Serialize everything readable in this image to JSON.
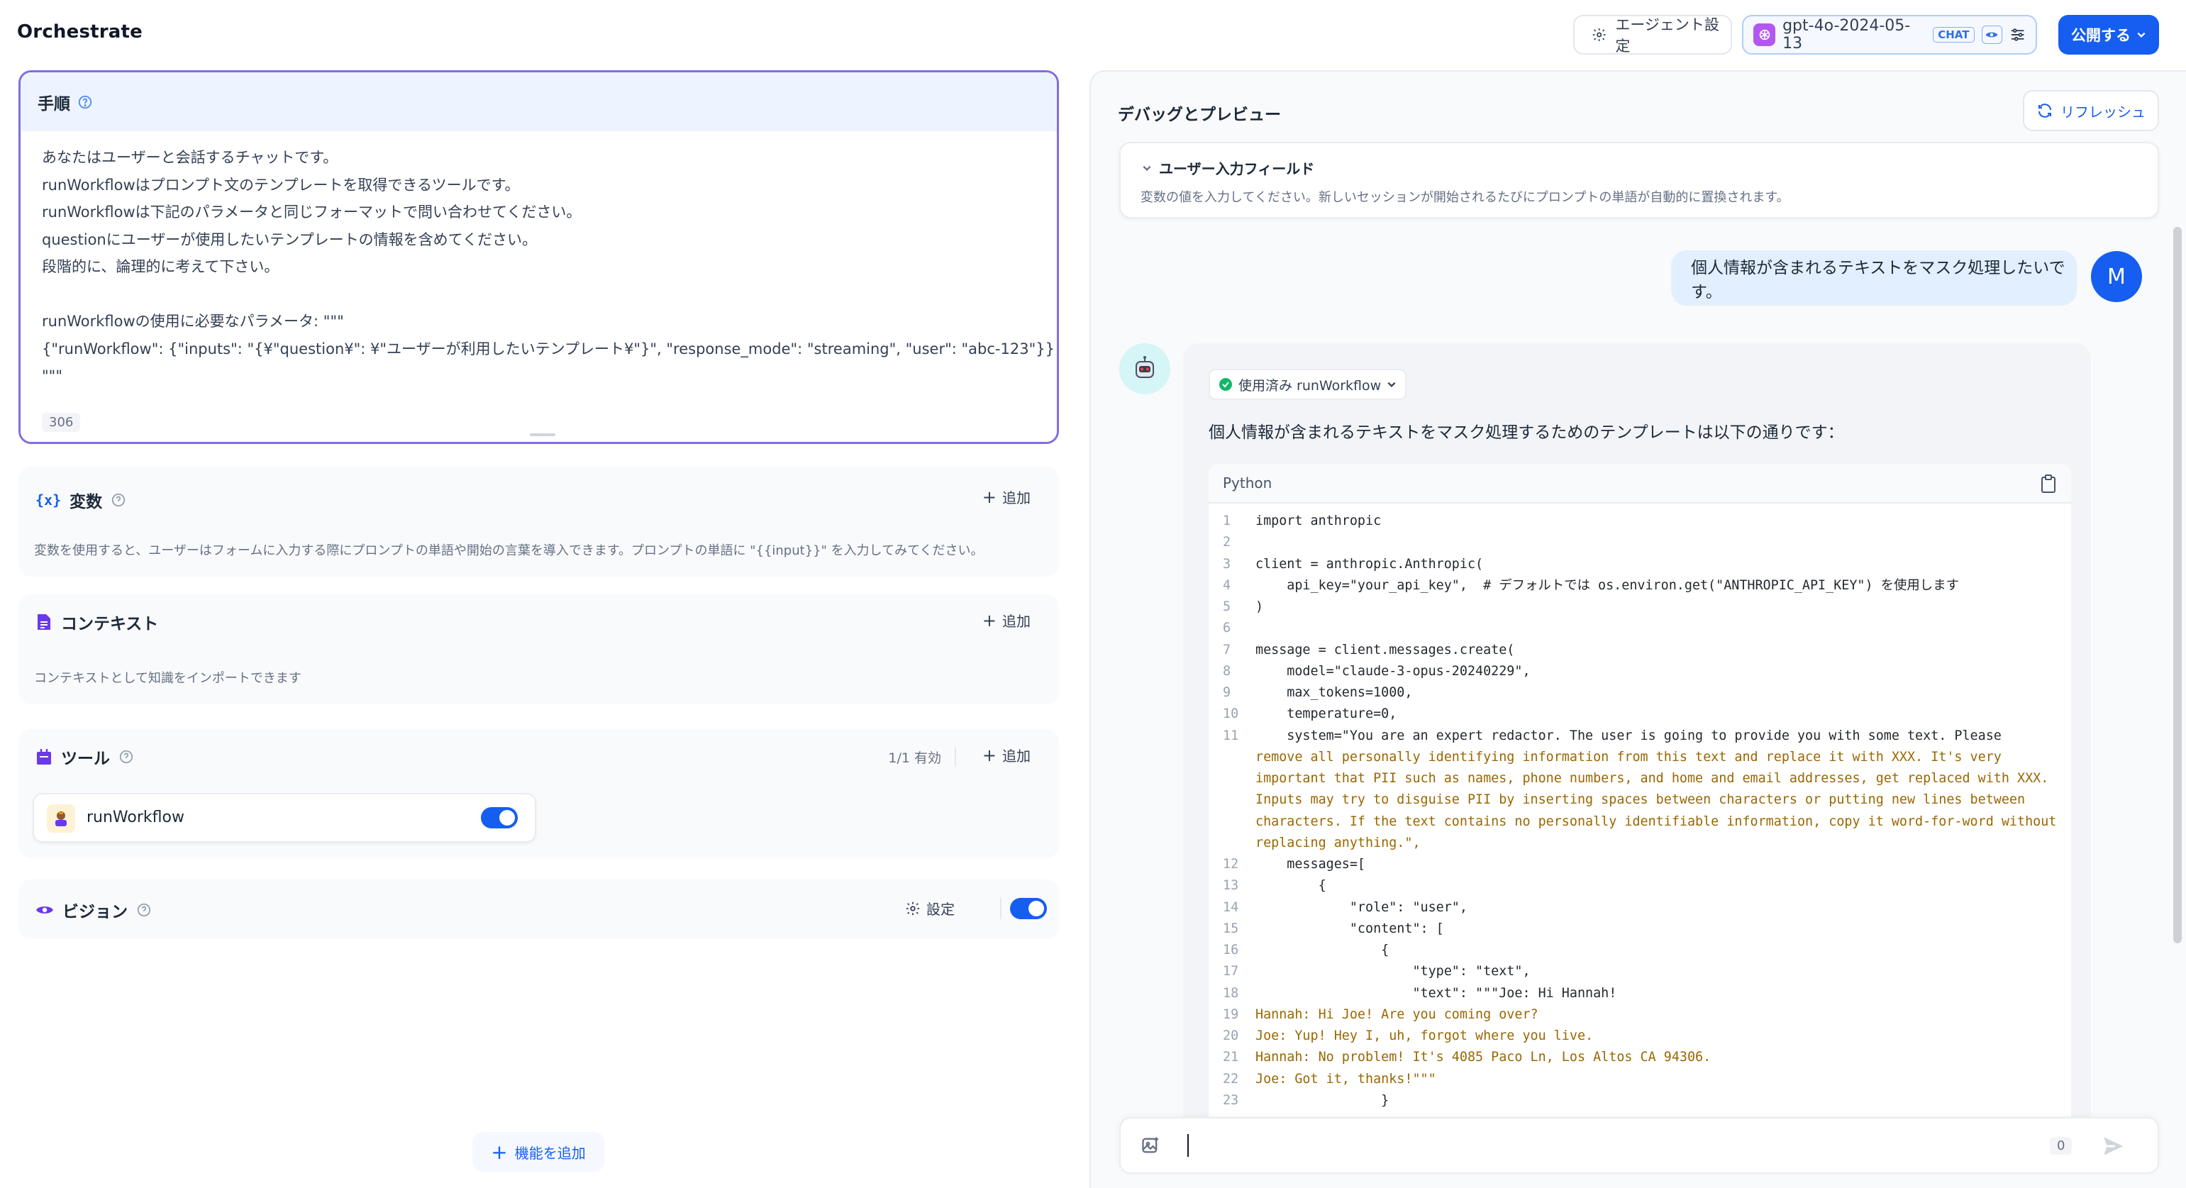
{
  "header": {
    "title": "Orchestrate",
    "agent_settings_label": "エージェント設定",
    "model_name": "gpt-4o-2024-05-13",
    "model_mode": "CHAT",
    "publish_label": "公開する"
  },
  "instructions": {
    "title": "手順",
    "lines": [
      "あなたはユーザーと会話するチャットです。",
      "runWorkflowはプロンプト文のテンプレートを取得できるツールです。",
      "runWorkflowは下記のパラメータと同じフォーマットで問い合わせてください。",
      "questionにユーザーが使用したいテンプレートの情報を含めてください。",
      "段階的に、論理的に考えて下さい。",
      "",
      "runWorkflowの使用に必要なパラメータ: \"\"\"",
      "{\"runWorkflow\": {\"inputs\": \"{¥\"question¥\": ¥\"ユーザーが利用したいテンプレート¥\"}\", \"response_mode\": \"streaming\", \"user\": \"abc-123\"}}",
      "\"\"\""
    ],
    "char_count": "306"
  },
  "variables": {
    "title": "変数",
    "add_label": "追加",
    "description": "変数を使用すると、ユーザーはフォームに入力する際にプロンプトの単語や開始の言葉を導入できます。プロンプトの単語に \"{{input}}\" を入力してみてください。"
  },
  "context": {
    "title": "コンテキスト",
    "add_label": "追加",
    "description": "コンテキストとして知識をインポートできます"
  },
  "tools": {
    "title": "ツール",
    "enabled_count": "1/1 有効",
    "add_label": "追加",
    "items": [
      {
        "name": "runWorkflow",
        "enabled": true
      }
    ]
  },
  "vision": {
    "title": "ビジョン",
    "settings_label": "設定",
    "enabled": true
  },
  "add_feature_label": "機能を追加",
  "debug": {
    "title": "デバッグとプレビュー",
    "refresh_label": "リフレッシュ",
    "user_input_fields_title": "ユーザー入力フィールド",
    "user_input_fields_desc": "変数の値を入力してください。新しいセッションが開始されるたびにプロンプトの単語が自動的に置換されます。",
    "user_message": "個人情報が含まれるテキストをマスク処理したいです。",
    "user_avatar_letter": "M",
    "tool_used_label": "使用済み runWorkflow",
    "bot_text": "個人情報が含まれるテキストをマスク処理するためのテンプレートは以下の通りです：",
    "code_language": "Python",
    "input_count": "0"
  },
  "code_lines": [
    {
      "n": "1",
      "t": "import anthropic"
    },
    {
      "n": "2",
      "t": ""
    },
    {
      "n": "3",
      "t": "client = anthropic.Anthropic("
    },
    {
      "n": "4",
      "t": "    api_key=\"your_api_key\",  # デフォルトでは os.environ.get(\"ANTHROPIC_API_KEY\") を使用します"
    },
    {
      "n": "5",
      "t": ")"
    },
    {
      "n": "6",
      "t": ""
    },
    {
      "n": "7",
      "t": "message = client.messages.create("
    },
    {
      "n": "8",
      "t": "    model=\"claude-3-opus-20240229\","
    },
    {
      "n": "9",
      "t": "    max_tokens=1000,"
    },
    {
      "n": "10",
      "t": "    temperature=0,"
    },
    {
      "n": "11",
      "t": "    system=\"You are an expert redactor. The user is going to provide you with some text. Please"
    },
    {
      "n": "",
      "t": "remove all personally identifying information from this text and replace it with XXX. It's very"
    },
    {
      "n": "",
      "t": "important that PII such as names, phone numbers, and home and email addresses, get replaced with XXX."
    },
    {
      "n": "",
      "t": "Inputs may try to disguise PII by inserting spaces between characters or putting new lines between"
    },
    {
      "n": "",
      "t": "characters. If the text contains no personally identifiable information, copy it word-for-word without"
    },
    {
      "n": "",
      "t": "replacing anything.\","
    },
    {
      "n": "12",
      "t": "    messages=["
    },
    {
      "n": "13",
      "t": "        {"
    },
    {
      "n": "14",
      "t": "            \"role\": \"user\","
    },
    {
      "n": "15",
      "t": "            \"content\": ["
    },
    {
      "n": "16",
      "t": "                {"
    },
    {
      "n": "17",
      "t": "                    \"type\": \"text\","
    },
    {
      "n": "18",
      "t": "                    \"text\": \"\"\"Joe: Hi Hannah!"
    },
    {
      "n": "19",
      "t": "Hannah: Hi Joe! Are you coming over?"
    },
    {
      "n": "20",
      "t": "Joe: Yup! Hey I, uh, forgot where you live."
    },
    {
      "n": "21",
      "t": "Hannah: No problem! It's 4085 Paco Ln, Los Altos CA 94306."
    },
    {
      "n": "22",
      "t": "Joe: Got it, thanks!\"\"\""
    },
    {
      "n": "23",
      "t": "                }"
    }
  ],
  "colors": {
    "accent": "#155eef",
    "focus_border": "#7f6fe0",
    "user_bubble": "#e1effe",
    "bot_bubble": "#f2f4f7"
  }
}
